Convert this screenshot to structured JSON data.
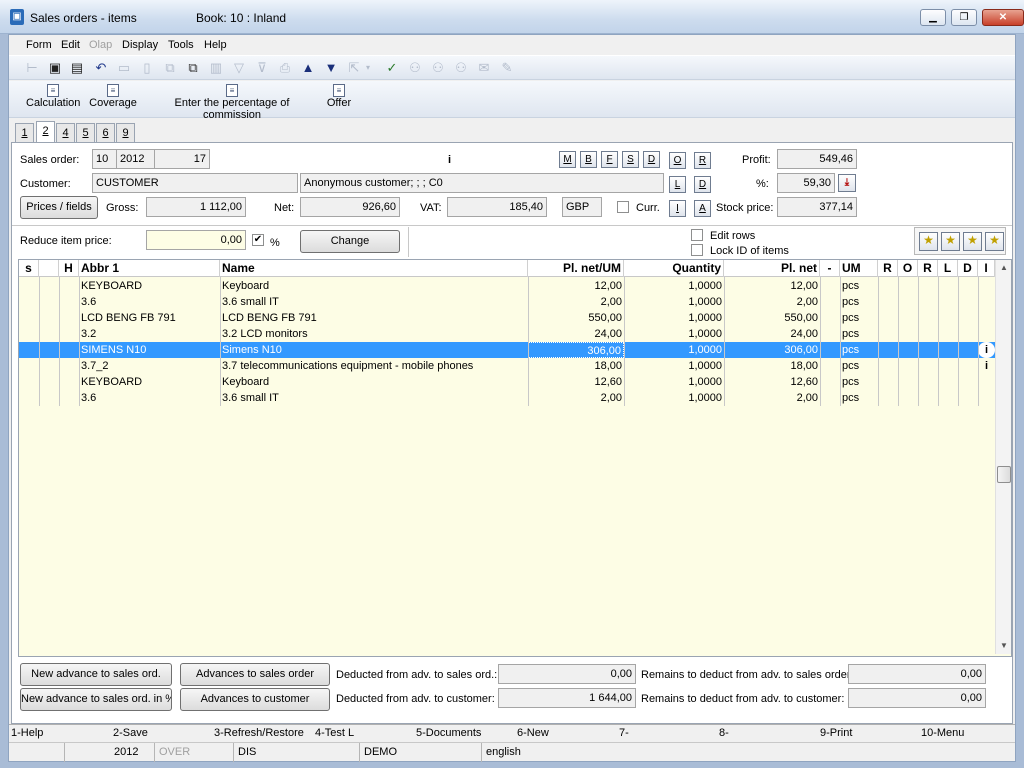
{
  "window": {
    "title": "Sales orders - items",
    "book": "Book: 10 : Inland",
    "minimize": "▁",
    "maximize": "❐",
    "close": "✕"
  },
  "menu": [
    "Form",
    "Edit",
    "Olap",
    "Display",
    "Tools",
    "Help"
  ],
  "menu_disabled": [
    "Olap"
  ],
  "toolbar_icons": [
    "tree-icon",
    "save-icon",
    "save-close-icon",
    "undo-icon",
    "open-icon",
    "new-icon",
    "copy-icon",
    "paste-icon",
    "book-icon",
    "filter-icon",
    "filter-clear-icon",
    "print-icon",
    "arrow-up-icon",
    "arrow-down-icon",
    "export-icon",
    "dropdown-icon",
    "find-check-icon",
    "binoculars-icon",
    "binoculars-next-icon",
    "binoculars-prev-icon",
    "mail-icon",
    "edit-icon"
  ],
  "toolbar2": [
    {
      "label": "Calculation"
    },
    {
      "label": "Coverage"
    },
    {
      "label": "Enter the percentage of commission"
    },
    {
      "label": "Offer"
    }
  ],
  "tabs": [
    "1",
    "2",
    "4",
    "5",
    "6",
    "9"
  ],
  "selected_tab": "2",
  "header": {
    "sales_order_label": "Sales order:",
    "sales_order_book": "10",
    "sales_order_year": "2012",
    "sales_order_number": "17",
    "info_flag": "i",
    "customer_label": "Customer:",
    "customer_value": "CUSTOMER",
    "customer_name": "Anonymous customer; ; ; C0",
    "prices_fields_button": "Prices / fields",
    "gross_label": "Gross:",
    "gross_value": "1 112,00",
    "net_label": "Net:",
    "net_value": "926,60",
    "vat_label": "VAT:",
    "vat_value": "185,40",
    "currency": "GBP",
    "curr_label": "Curr.",
    "letter_buttons": [
      "M",
      "B",
      "F",
      "S",
      "D"
    ],
    "side_buttons": [
      "O",
      "R",
      "L",
      "D",
      "I",
      "A"
    ],
    "profit_label": "Profit:",
    "profit_value": "549,46",
    "percent_label": "%:",
    "percent_value": "59,30",
    "stock_price_label": "Stock price:",
    "stock_price_value": "377,14",
    "reduce_label": "Reduce item price:",
    "reduce_value": "0,00",
    "reduce_pct_label": "%",
    "change_button": "Change",
    "edit_rows_label": "Edit rows",
    "lock_id_label": "Lock ID of items",
    "star_icons": [
      "star-icon",
      "star-add-icon",
      "star-edit-icon",
      "star-delete-icon"
    ]
  },
  "grid": {
    "columns": [
      "s",
      "",
      "H",
      "Abbr 1",
      "Name",
      "Pl. net/UM",
      "Quantity",
      "Pl. net",
      "-",
      "UM",
      "R",
      "O",
      "R",
      "L",
      "D",
      "I"
    ],
    "rows": [
      {
        "abbr": "KEYBOARD",
        "name": "Keyboard",
        "plnetum": "12,00",
        "qty": "1,0000",
        "plnet": "12,00",
        "um": "pcs",
        "i": ""
      },
      {
        "abbr": "3.6",
        "name": "3.6 small IT",
        "plnetum": "2,00",
        "qty": "1,0000",
        "plnet": "2,00",
        "um": "pcs",
        "i": ""
      },
      {
        "abbr": "LCD BENG FB 791",
        "name": "LCD BENG FB 791",
        "plnetum": "550,00",
        "qty": "1,0000",
        "plnet": "550,00",
        "um": "pcs",
        "i": ""
      },
      {
        "abbr": "3.2",
        "name": "3.2 LCD monitors",
        "plnetum": "24,00",
        "qty": "1,0000",
        "plnet": "24,00",
        "um": "pcs",
        "i": ""
      },
      {
        "abbr": "SIMENS N10",
        "name": "Simens N10",
        "plnetum": "306,00",
        "qty": "1,0000",
        "plnet": "306,00",
        "um": "pcs",
        "i": "i"
      },
      {
        "abbr": "3.7_2",
        "name": "3.7  telecommunications equipment - mobile phones",
        "plnetum": "18,00",
        "qty": "1,0000",
        "plnet": "18,00",
        "um": "pcs",
        "i": "i"
      },
      {
        "abbr": "KEYBOARD",
        "name": "Keyboard",
        "plnetum": "12,60",
        "qty": "1,0000",
        "plnet": "12,60",
        "um": "pcs",
        "i": ""
      },
      {
        "abbr": "3.6",
        "name": "3.6 small IT",
        "plnetum": "2,00",
        "qty": "1,0000",
        "plnet": "2,00",
        "um": "pcs",
        "i": ""
      }
    ],
    "selected_row": 4
  },
  "advances": {
    "new_advance_btn": "New advance to sales ord.",
    "advances_to_order_btn": "Advances to sales order",
    "new_advance_pct_btn": "New advance to sales ord. in %",
    "advances_to_customer_btn": "Advances to customer",
    "deducted_order_label": "Deducted from adv. to sales ord.:",
    "deducted_order_value": "0,00",
    "remains_order_label": "Remains to deduct from adv. to sales order:",
    "remains_order_value": "0,00",
    "deducted_customer_label": "Deducted from adv. to customer:",
    "deducted_customer_value": "1 644,00",
    "remains_customer_label": "Remains to deduct from adv. to customer:",
    "remains_customer_value": "0,00"
  },
  "fkeys": [
    "1-Help",
    "2-Save",
    "3-Refresh/Restore",
    "4-Test L",
    "5-Documents",
    "6-New",
    "7-",
    "8-",
    "9-Print",
    "10-Menu"
  ],
  "status": {
    "year": "2012",
    "mode": "OVER",
    "dis": "DIS",
    "db": "DEMO",
    "language": "english"
  },
  "colors": {
    "selection": "#3399ff",
    "grid_background": "#fdfde5",
    "title_gradient": "#cddcee"
  }
}
